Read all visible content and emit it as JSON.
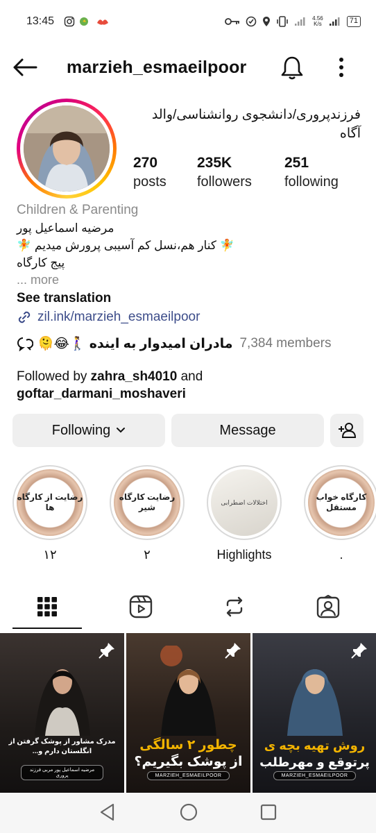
{
  "status_bar": {
    "time": "13:45",
    "network_speed": "4.56",
    "network_unit": "K/s",
    "battery": "71"
  },
  "header": {
    "username": "marzieh_esmaeilpoor"
  },
  "profile": {
    "full_name": "فرزندپروری/دانشجوی روانشناسی/والد آگاه",
    "stats": {
      "posts": "270",
      "posts_label": "posts",
      "followers": "235K",
      "followers_label": "followers",
      "following": "251",
      "following_label": "following"
    },
    "category": "Children & Parenting",
    "bio_lines": [
      "مرضیه اسماعیل پور",
      "🧚 کنار هم،نسل کم آسیبی پرورش میدیم 🧚",
      "پیج کارگاه"
    ],
    "more": "... more",
    "see_translation": "See translation",
    "link": "zil.ink/marzieh_esmaeilpoor",
    "channel_name": "مادران امیدوار به اینده 🚶‍♀️😂🫠",
    "channel_members": "7,384 members",
    "followed_by_prefix": "Followed by ",
    "followed_by_user1": "zahra_sh4010",
    "followed_by_and": " and",
    "followed_by_user2": "goftar_darmani_moshaveri"
  },
  "buttons": {
    "following": "Following",
    "message": "Message"
  },
  "highlights": [
    {
      "inner_text": "رضایت از کارگاه ها",
      "caption": "۱۲"
    },
    {
      "inner_text": "رضایت کارگاه شیر",
      "caption": "۲"
    },
    {
      "inner_text": "اختلالات اضطرابی",
      "caption": "Highlights"
    },
    {
      "inner_text": "کارگاه خواب مستقل",
      "caption": "."
    }
  ],
  "posts": [
    {
      "text": "مدرک مشاور از پوشک گرفتن از انگلستان دارم و...",
      "watermark": "مرضیه اسماعیل پور مربی فرزند پروری"
    },
    {
      "text_top": "چطور ۲ سالگی",
      "text_bottom": "از پوشک بگیریم؟",
      "watermark": "MARZIEH_ESMAEILPOOR"
    },
    {
      "text_top": "روش تهیه بچه ی",
      "text_bottom": "پرتوقع و مهرطلب",
      "watermark": "MARZIEH_ESMAEILPOOR"
    }
  ],
  "colors": {
    "link": "#3d4d8a",
    "muted": "#8a8a8a",
    "button_bg": "#efefef",
    "accent_yellow": "#f3b400"
  }
}
